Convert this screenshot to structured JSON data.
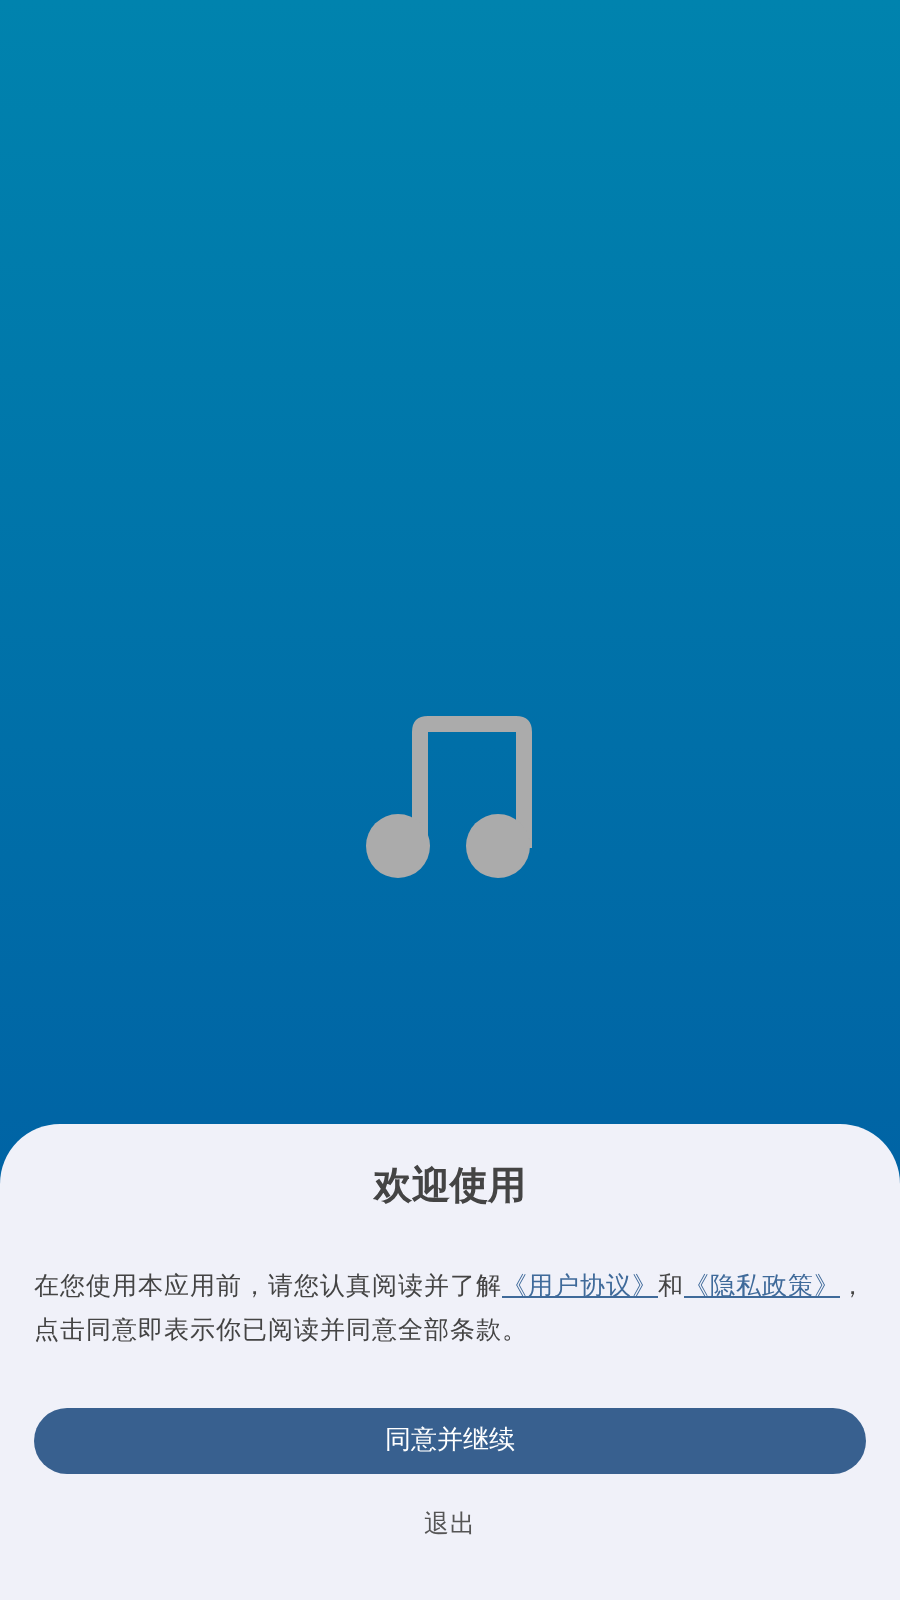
{
  "dialog": {
    "title": "欢迎使用",
    "message": [
      {
        "kind": "text",
        "text": "在您使用本应用前，请您认真阅读并了解"
      },
      {
        "kind": "link",
        "text": "《用户协议》"
      },
      {
        "kind": "text",
        "text": "和"
      },
      {
        "kind": "link",
        "text": "《隐私政策》"
      },
      {
        "kind": "text",
        "text": "，点击同意即表示你已阅读并同意全部条款。"
      }
    ],
    "primary_button": "同意并继续",
    "secondary_button": "退出"
  }
}
